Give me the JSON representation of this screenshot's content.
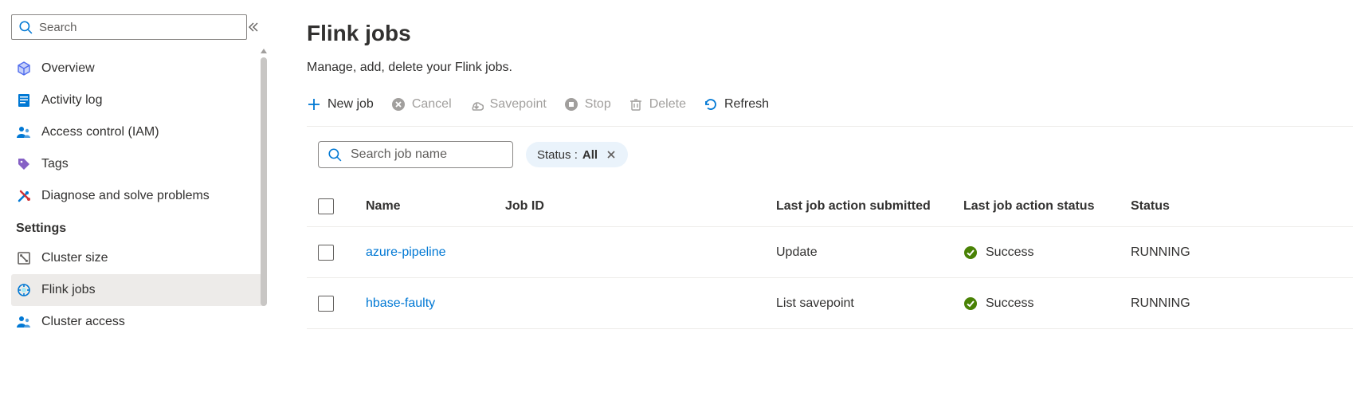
{
  "sidebar": {
    "search_placeholder": "Search",
    "items": [
      {
        "label": "Overview"
      },
      {
        "label": "Activity log"
      },
      {
        "label": "Access control (IAM)"
      },
      {
        "label": "Tags"
      },
      {
        "label": "Diagnose and solve problems"
      }
    ],
    "section_label": "Settings",
    "settings_items": [
      {
        "label": "Cluster size"
      },
      {
        "label": "Flink jobs"
      },
      {
        "label": "Cluster access"
      }
    ]
  },
  "main": {
    "title": "Flink jobs",
    "subtitle": "Manage, add, delete your Flink jobs.",
    "toolbar": {
      "new_job": "New job",
      "cancel": "Cancel",
      "savepoint": "Savepoint",
      "stop": "Stop",
      "delete": "Delete",
      "refresh": "Refresh"
    },
    "job_search_placeholder": "Search job name",
    "filter": {
      "label": "Status : ",
      "value": "All"
    },
    "columns": {
      "name": "Name",
      "job_id": "Job ID",
      "last_action": "Last job action submitted",
      "last_status": "Last job action status",
      "status": "Status"
    },
    "rows": [
      {
        "name": "azure-pipeline",
        "job_id": "",
        "last_action": "Update",
        "last_status": "Success",
        "status": "RUNNING"
      },
      {
        "name": "hbase-faulty",
        "job_id": "",
        "last_action": "List savepoint",
        "last_status": "Success",
        "status": "RUNNING"
      }
    ]
  }
}
